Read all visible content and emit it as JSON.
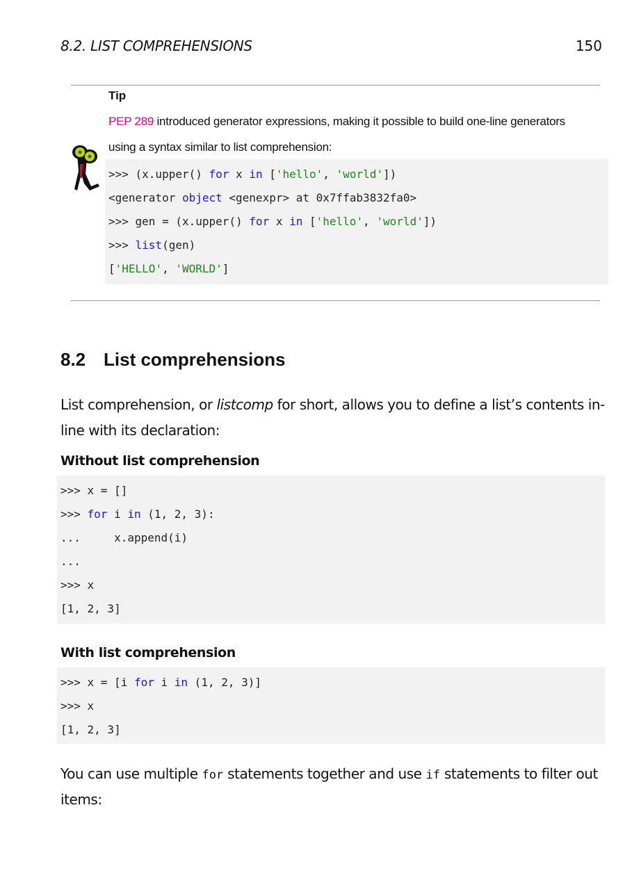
{
  "header": {
    "section": "8.2.  LIST COMPREHENSIONS",
    "page": "150"
  },
  "tip": {
    "title": "Tip",
    "pep_link": "PEP 289",
    "line1_rest": " introduced generator expressions, making it possible to build one-line generators",
    "line2": "using a syntax similar to list comprehension:",
    "code": {
      "l1": [
        ">>> (x.upper() ",
        "for",
        " x ",
        "in",
        " [",
        "'hello'",
        ", ",
        "'world'",
        "])"
      ],
      "l2": [
        "<generator ",
        "object",
        " <genexpr> at 0x7ffab3832fa0>"
      ],
      "l3": [
        ">>> gen = (x.upper() ",
        "for",
        " x ",
        "in",
        " [",
        "'hello'",
        ", ",
        "'world'",
        "])"
      ],
      "l4": [
        ">>> ",
        "list",
        "(gen)"
      ],
      "l5": [
        "[",
        "'HELLO'",
        ", ",
        "'WORLD'",
        "]"
      ]
    }
  },
  "section": {
    "number": "8.2",
    "title": "List comprehensions"
  },
  "intro": {
    "line1_a": "List comprehension, or ",
    "line1_em": "listcomp",
    "line1_b": " for short, allows you to define a list’s contents in-",
    "line2": "line with its declaration:"
  },
  "without": {
    "heading": "Without list comprehension",
    "code": {
      "l1": ">>> x = []",
      "l2": [
        ">>> ",
        "for",
        " i ",
        "in",
        " (1, 2, 3):"
      ],
      "l3": "...     x.append(i)",
      "l4": "...",
      "l5": ">>> x",
      "l6": "[1, 2, 3]"
    }
  },
  "with": {
    "heading": "With list comprehension",
    "code": {
      "l1": [
        ">>> x = [i ",
        "for",
        " i ",
        "in",
        " (1, 2, 3)]"
      ],
      "l2": ">>> x",
      "l3": "[1, 2, 3]"
    }
  },
  "outro": {
    "a": "You can use multiple ",
    "for_kw": "for",
    "b": " statements together and use ",
    "if_kw": "if",
    "c": " statements to filter out",
    "line2": "items:"
  }
}
